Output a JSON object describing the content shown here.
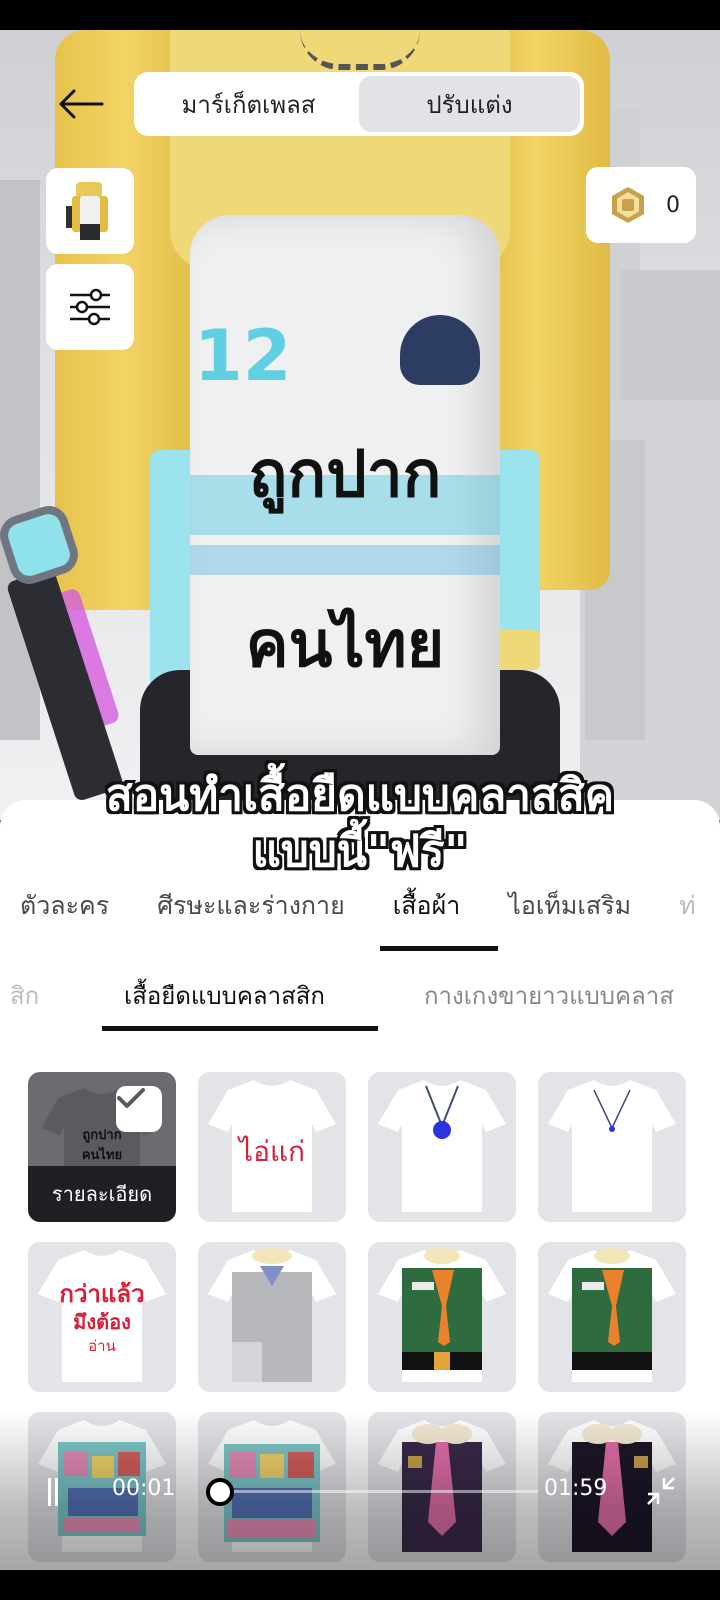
{
  "header": {
    "segmented": [
      {
        "label": "มาร์เก็ตเพลส",
        "active": false
      },
      {
        "label": "ปรับแต่ง",
        "active": true
      }
    ],
    "robux_count": "0"
  },
  "shirt_print": [
    "ถูกปาก",
    "คนไทย"
  ],
  "caption": {
    "line1": "สอนทำเสื้อยืดแบบคลาสสิค",
    "line2": "แบบนี้\"ฟรี\""
  },
  "category_tabs": [
    {
      "label": "ตัวละคร",
      "active": false
    },
    {
      "label": "ศีรษะและร่างกาย",
      "active": false
    },
    {
      "label": "เสื้อผ้า",
      "active": true
    },
    {
      "label": "ไอเท็มเสริม",
      "active": false
    },
    {
      "label": "ท่",
      "active": false
    }
  ],
  "sub_tabs": [
    {
      "label": "สิก",
      "active": false
    },
    {
      "label": "เสื้อยืดแบบคลาสสิก",
      "active": true
    },
    {
      "label": "กางเกงขายาวแบบคลาส",
      "active": false
    }
  ],
  "items": [
    {
      "text1": "ถูกปาก",
      "text2": "คนไทย",
      "selected": true,
      "details_label": "รายละเอียด"
    },
    {
      "text1": "ไอ่แก่",
      "text2": ""
    },
    {
      "text1": "",
      "text2": ""
    },
    {
      "text1": "",
      "text2": ""
    },
    {
      "text1": "กว่าแล้ว",
      "text2": "มึงต้อง",
      "text3": "อ่าน"
    },
    {
      "text1": "",
      "text2": ""
    },
    {
      "text1": "",
      "text2": ""
    },
    {
      "text1": "",
      "text2": ""
    },
    {
      "text1": "",
      "text2": ""
    },
    {
      "text1": "",
      "text2": ""
    },
    {
      "text1": "",
      "text2": ""
    },
    {
      "text1": "",
      "text2": ""
    }
  ],
  "video": {
    "elapsed": "00:01",
    "total": "01:59",
    "progress": 0.01
  },
  "colors": {
    "accent_dark": "#1f2024",
    "tile_bg": "#e3e4e8",
    "text_red": "#d81f3a"
  }
}
